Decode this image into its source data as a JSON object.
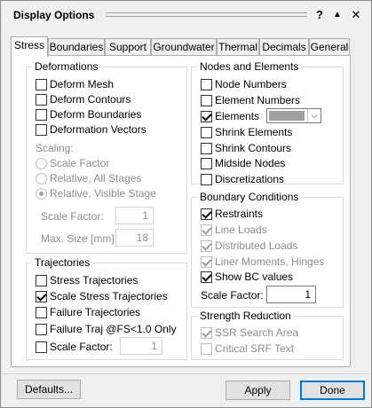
{
  "window": {
    "title": "Display Options",
    "help_button": "?",
    "collapse_button": "▲",
    "close_button": "✕"
  },
  "tabs": [
    {
      "label": "Stress",
      "active": true
    },
    {
      "label": "Boundaries",
      "active": false
    },
    {
      "label": "Support",
      "active": false
    },
    {
      "label": "Groundwater",
      "active": false
    },
    {
      "label": "Thermal",
      "active": false
    },
    {
      "label": "Decimals",
      "active": false
    },
    {
      "label": "General",
      "active": false
    }
  ],
  "deformations": {
    "label": "Deformations",
    "options": [
      {
        "label": "Deform Mesh",
        "checked": false
      },
      {
        "label": "Deform Contours",
        "checked": false
      },
      {
        "label": "Deform Boundaries",
        "checked": false
      },
      {
        "label": "Deformation Vectors",
        "checked": false
      }
    ],
    "scaling_label": "Scaling:",
    "scaling_options": [
      {
        "label": "Scale Factor",
        "selected": false
      },
      {
        "label": "Relative, All Stages",
        "selected": false
      },
      {
        "label": "Relative, Visible Stage",
        "selected": true
      }
    ],
    "scale_factor_label": "Scale Factor:",
    "scale_factor_value": "1",
    "max_size_label": "Max. Size [mm]:",
    "max_size_value": "18"
  },
  "trajectories": {
    "label": "Trajectories",
    "options": [
      {
        "label": "Stress Trajectories",
        "checked": false
      },
      {
        "label": "Scale Stress Trajectories",
        "checked": true
      },
      {
        "label": "Failure Trajectories",
        "checked": false
      },
      {
        "label": "Failure Traj @FS<1.0 Only",
        "checked": false
      }
    ],
    "scale_factor_label": "Scale Factor:",
    "scale_factor_checked": false,
    "scale_factor_value": "1"
  },
  "nodes_elements": {
    "label": "Nodes and Elements",
    "options": [
      {
        "label": "Node Numbers",
        "checked": false
      },
      {
        "label": "Element Numbers",
        "checked": false
      },
      {
        "label": "Elements",
        "checked": true
      },
      {
        "label": "Shrink Elements",
        "checked": false
      },
      {
        "label": "Shrink Contours",
        "checked": false
      },
      {
        "label": "Midside Nodes",
        "checked": false
      },
      {
        "label": "Discretizations",
        "checked": false
      }
    ],
    "elements_color": "#a0a0a0"
  },
  "boundary_conditions": {
    "label": "Boundary Conditions",
    "options": [
      {
        "label": "Restraints",
        "checked": true,
        "disabled": false
      },
      {
        "label": "Line Loads",
        "checked": true,
        "disabled": true
      },
      {
        "label": "Distributed Loads",
        "checked": true,
        "disabled": true
      },
      {
        "label": "Liner Moments, Hinges",
        "checked": true,
        "disabled": true
      },
      {
        "label": "Show BC values",
        "checked": true,
        "disabled": false
      }
    ],
    "scale_factor_label": "Scale Factor:",
    "scale_factor_value": "1"
  },
  "strength_reduction": {
    "label": "Strength Reduction",
    "options": [
      {
        "label": "SSR Search Area",
        "checked": true,
        "disabled": true
      },
      {
        "label": "Critical SRF Text",
        "checked": false,
        "disabled": true
      }
    ]
  },
  "footer": {
    "defaults_label": "Defaults...",
    "apply_label": "Apply",
    "done_label": "Done"
  },
  "colors": {
    "accent": "#0078d7",
    "window_bg": "#f0f0f0",
    "panel_bg": "#ffffff",
    "disabled_text": "#8d8d8d"
  }
}
